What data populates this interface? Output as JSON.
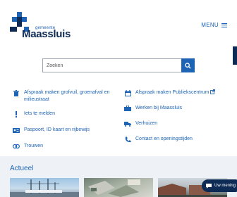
{
  "header": {
    "logo_small": "gemeente",
    "logo_big": "Maassluis",
    "menu_label": "MENU"
  },
  "search": {
    "placeholder": "Zoeken"
  },
  "quicklinks": [
    {
      "label": "Afspraak maken grofvuil, groenafval en milieustraat",
      "icon": "bin-icon"
    },
    {
      "label": "Afspraak maken Publiekscentrum",
      "icon": "calendar-icon",
      "external": true
    },
    {
      "label": "Iets te melden",
      "icon": "exclamation-icon"
    },
    {
      "label": "Werken bij Maassluis",
      "icon": "briefcase-icon"
    },
    {
      "label": "Paspoort, ID kaart en rijbewijs",
      "icon": "id-card-icon"
    },
    {
      "label": "Verhuizen",
      "icon": "moving-truck-icon"
    },
    {
      "label": "Trouwen",
      "icon": "rings-icon"
    },
    {
      "label": "Contact en openingstijden",
      "icon": "phone-icon"
    }
  ],
  "actueel": {
    "title": "Actueel"
  },
  "chat": {
    "label": "Uw mening"
  },
  "colors": {
    "primary": "#1e64b4",
    "dark": "#0e2b55"
  }
}
